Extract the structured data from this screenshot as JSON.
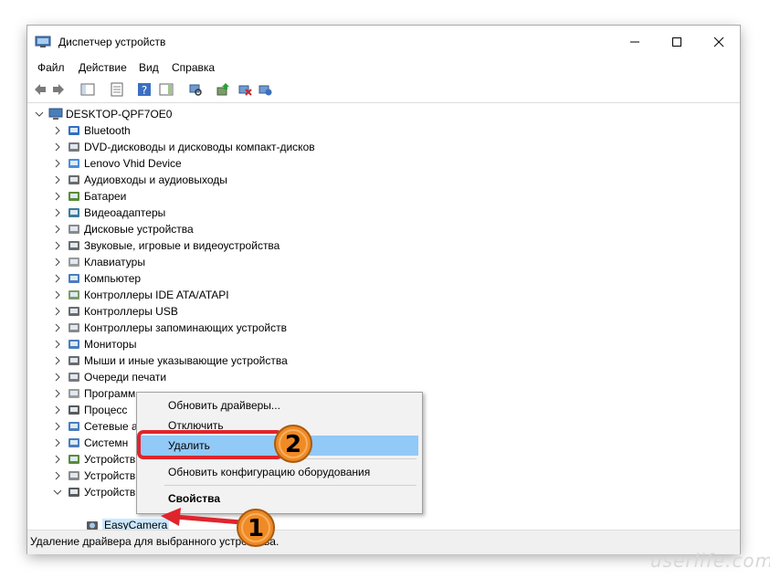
{
  "window": {
    "title": "Диспетчер устройств"
  },
  "menu": [
    "Файл",
    "Действие",
    "Вид",
    "Справка"
  ],
  "tree": {
    "root": "DESKTOP-QPF7OE0",
    "categories": [
      "Bluetooth",
      "DVD-дисководы и дисководы компакт-дисков",
      "Lenovo Vhid Device",
      "Аудиовходы и аудиовыходы",
      "Батареи",
      "Видеоадаптеры",
      "Дисковые устройства",
      "Звуковые, игровые и видеоустройства",
      "Клавиатуры",
      "Компьютер",
      "Контроллеры IDE ATA/ATAPI",
      "Контроллеры USB",
      "Контроллеры запоминающих устройств",
      "Мониторы",
      "Мыши и иные указывающие устройства",
      "Очереди печати",
      "Программ",
      "Процесс",
      "Сетевые а",
      "Системн",
      "Устройств",
      "Устройств",
      "Устройств"
    ],
    "child": "EasyCamera"
  },
  "context_menu": {
    "update": "Обновить драйверы...",
    "disable": "Отключить",
    "delete": "Удалить",
    "scan": "Обновить конфигурацию оборудования",
    "properties": "Свойства"
  },
  "status": "Удаление драйвера для выбранного устройства.",
  "annotations": {
    "badge1": "1",
    "badge2": "2"
  },
  "watermark": "userlife.com",
  "colors": {
    "highlight": "#91c9f7",
    "badge_orange": "#f08a24",
    "arrow_red": "#e0242c"
  }
}
